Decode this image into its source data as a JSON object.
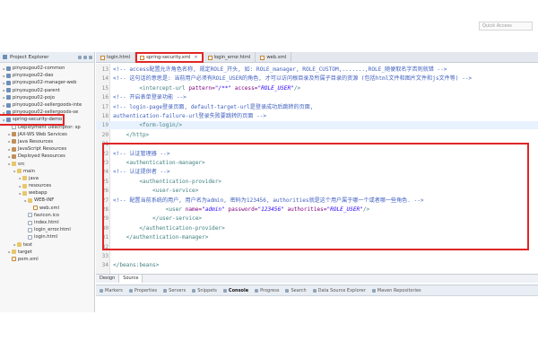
{
  "header": {
    "quick_access": "Quick Access"
  },
  "explorer": {
    "title": "Project Explorer",
    "items": [
      {
        "label": "pinyougou02-common",
        "depth": 0,
        "type": "proj"
      },
      {
        "label": "pinyougou02-dao",
        "depth": 0,
        "type": "proj"
      },
      {
        "label": "pinyougou02-manager-web",
        "depth": 0,
        "type": "proj"
      },
      {
        "label": "pinyougou02-parent",
        "depth": 0,
        "type": "proj"
      },
      {
        "label": "pinyougou02-pojo",
        "depth": 0,
        "type": "proj"
      },
      {
        "label": "pinyougou02-sellergoods-inte",
        "depth": 0,
        "type": "proj"
      },
      {
        "label": "pinyougou02-sellergoods-se",
        "depth": 0,
        "type": "proj"
      },
      {
        "label": "spring-security-demo",
        "depth": 0,
        "type": "proj",
        "selected": true
      },
      {
        "label": "Deployment Descriptor: sp",
        "depth": 1,
        "type": "file"
      },
      {
        "label": "JAX-WS Web Services",
        "depth": 1,
        "type": "lib"
      },
      {
        "label": "Java Resources",
        "depth": 1,
        "type": "lib"
      },
      {
        "label": "JavaScript Resources",
        "depth": 1,
        "type": "lib"
      },
      {
        "label": "Deployed Resources",
        "depth": 1,
        "type": "lib"
      },
      {
        "label": "src",
        "depth": 1,
        "type": "folder"
      },
      {
        "label": "main",
        "depth": 2,
        "type": "folder"
      },
      {
        "label": "java",
        "depth": 3,
        "type": "folder"
      },
      {
        "label": "resources",
        "depth": 3,
        "type": "folder"
      },
      {
        "label": "webapp",
        "depth": 3,
        "type": "folder"
      },
      {
        "label": "WEB-INF",
        "depth": 4,
        "type": "folder"
      },
      {
        "label": "web.xml",
        "depth": 5,
        "type": "xml"
      },
      {
        "label": "favicon.ico",
        "depth": 4,
        "type": "file"
      },
      {
        "label": "index.html",
        "depth": 4,
        "type": "file"
      },
      {
        "label": "login_error.html",
        "depth": 4,
        "type": "file"
      },
      {
        "label": "login.html",
        "depth": 4,
        "type": "file"
      },
      {
        "label": "test",
        "depth": 2,
        "type": "folder"
      },
      {
        "label": "target",
        "depth": 1,
        "type": "folder"
      },
      {
        "label": "pom.xml",
        "depth": 1,
        "type": "xml"
      }
    ]
  },
  "editor": {
    "tabs": [
      {
        "label": "login.html",
        "active": false
      },
      {
        "label": "spring-security.xml",
        "active": true
      },
      {
        "label": "login_error.html",
        "active": false
      },
      {
        "label": "web.xml",
        "active": false
      }
    ],
    "lines": [
      {
        "n": "13",
        "parts": [
          [
            "c",
            "<!-- access配置允许角色名称, 规定ROLE_开头, 如: ROLE_manager, ROLE_CUSTOM,.......,ROLE_随便取名字否则就错 -->"
          ]
        ]
      },
      {
        "n": "14",
        "parts": [
          [
            "c",
            "<!-- 这句话的意思是: 当前用户必须有ROLE_USER的角色, 才可以访问根目录及所属子目录的资源 (包括html文件和图片文件和js文件等) -->"
          ]
        ]
      },
      {
        "n": "15",
        "parts": [
          [
            "t",
            "        <intercept-url "
          ],
          [
            "a",
            "pattern="
          ],
          [
            "v",
            "\"/**\""
          ],
          [
            "a",
            " access="
          ],
          [
            "v",
            "\"ROLE_USER\""
          ],
          [
            "t",
            "/>"
          ]
        ]
      },
      {
        "n": "16",
        "parts": [
          [
            "c",
            "<!-- 开启表单登录功能 -->"
          ]
        ]
      },
      {
        "n": "17",
        "parts": [
          [
            "c",
            "<!-- login-page登录页面, default-target-url是登录成功后跳转的页面,"
          ]
        ]
      },
      {
        "n": "18",
        "parts": [
          [
            "c",
            "authentication-failure-url登录失败要跳转的页面 -->"
          ]
        ]
      },
      {
        "n": "19",
        "parts": [
          [
            "t",
            "        <form-login/>"
          ]
        ],
        "hl": true
      },
      {
        "n": "20",
        "parts": [
          [
            "t",
            "    </http>"
          ]
        ]
      },
      {
        "n": "21",
        "parts": [
          [
            "t",
            ""
          ]
        ]
      },
      {
        "n": "22",
        "parts": [
          [
            "c",
            "<!-- 认证管理器 -->"
          ]
        ]
      },
      {
        "n": "23",
        "parts": [
          [
            "t",
            "    <authentication-manager>"
          ]
        ]
      },
      {
        "n": "24",
        "parts": [
          [
            "c",
            "<!-- 认证提供者 -->"
          ]
        ]
      },
      {
        "n": "25",
        "parts": [
          [
            "t",
            "        <authentication-provider>"
          ]
        ]
      },
      {
        "n": "26",
        "parts": [
          [
            "t",
            "            <user-service>"
          ]
        ]
      },
      {
        "n": "27",
        "parts": [
          [
            "c",
            "<!-- 配置当前系统的用户, 用户名为admin, 密码为123456, authorities就是这个用户属于哪一个或者哪一些角色. -->"
          ]
        ]
      },
      {
        "n": "28",
        "parts": [
          [
            "t",
            "                <user "
          ],
          [
            "a",
            "name="
          ],
          [
            "v",
            "\"admin\""
          ],
          [
            "a",
            " password="
          ],
          [
            "v",
            "\"123456\""
          ],
          [
            "a",
            " authorities="
          ],
          [
            "v",
            "\"ROLE_USER\""
          ],
          [
            "t",
            "/>"
          ]
        ]
      },
      {
        "n": "29",
        "parts": [
          [
            "t",
            "            </user-service>"
          ]
        ]
      },
      {
        "n": "30",
        "parts": [
          [
            "t",
            "        </authentication-provider>"
          ]
        ]
      },
      {
        "n": "31",
        "parts": [
          [
            "t",
            "    </authentication-manager>"
          ]
        ]
      },
      {
        "n": "32",
        "parts": [
          [
            "t",
            ""
          ]
        ]
      },
      {
        "n": "33",
        "parts": [
          [
            "t",
            ""
          ]
        ]
      },
      {
        "n": "34",
        "parts": [
          [
            "t",
            "</beans:beans>"
          ]
        ]
      }
    ]
  },
  "design_tabs": [
    {
      "label": "Design",
      "active": false
    },
    {
      "label": "Source",
      "active": true
    }
  ],
  "bottom_tabs": [
    {
      "label": "Markers",
      "active": false
    },
    {
      "label": "Properties",
      "active": false
    },
    {
      "label": "Servers",
      "active": false
    },
    {
      "label": "Snippets",
      "active": false
    },
    {
      "label": "Console",
      "active": true
    },
    {
      "label": "Progress",
      "active": false
    },
    {
      "label": "Search",
      "active": false
    },
    {
      "label": "Data Source Explorer",
      "active": false
    },
    {
      "label": "Maven Repositories",
      "active": false
    }
  ]
}
